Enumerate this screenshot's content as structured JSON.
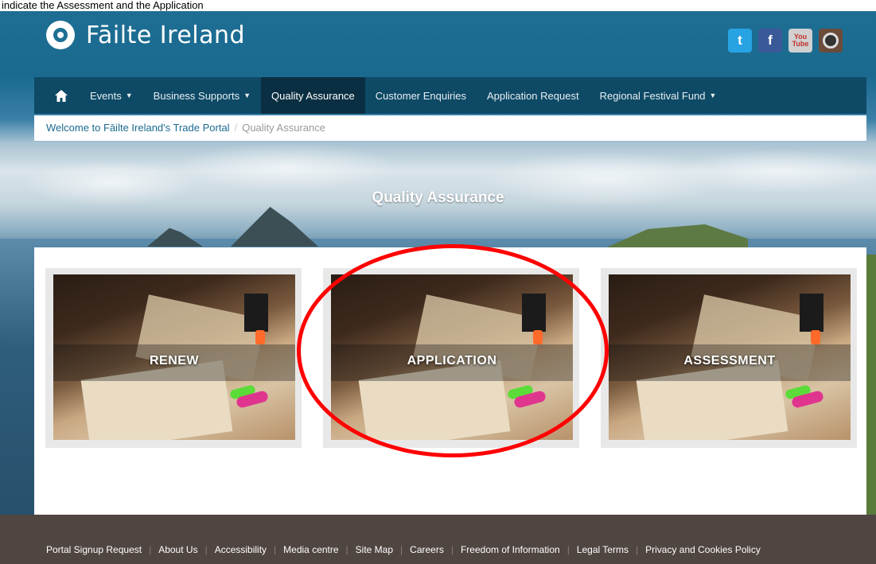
{
  "note": "indicate the Assessment and the Application",
  "header": {
    "brand": "Fāilte Ireland",
    "social": [
      {
        "name": "twitter",
        "glyph": "t"
      },
      {
        "name": "facebook",
        "glyph": "f"
      },
      {
        "name": "youtube",
        "glyph": "You Tube"
      },
      {
        "name": "instagram",
        "glyph": ""
      }
    ]
  },
  "nav": {
    "home_icon": "home-icon",
    "items": [
      {
        "label": "Events",
        "dropdown": true
      },
      {
        "label": "Business Supports",
        "dropdown": true
      },
      {
        "label": "Quality Assurance",
        "active": true
      },
      {
        "label": "Customer Enquiries"
      },
      {
        "label": "Application Request"
      },
      {
        "label": "Regional Festival Fund",
        "dropdown": true
      }
    ],
    "caret": "▼"
  },
  "breadcrumb": {
    "home": "Welcome to Fāilte Ireland's Trade Portal",
    "separator": "/",
    "current": "Quality Assurance"
  },
  "hero": {
    "title": "Quality Assurance"
  },
  "tiles": [
    {
      "label": "RENEW"
    },
    {
      "label": "APPLICATION"
    },
    {
      "label": "ASSESSMENT"
    }
  ],
  "annotation": {
    "color": "#ff0000"
  },
  "footer": {
    "links": [
      "Portal Signup Request",
      "About Us",
      "Accessibility",
      "Media centre",
      "Site Map",
      "Careers",
      "Freedom of Information",
      "Legal Terms",
      "Privacy and Cookies Policy"
    ],
    "separator": "|"
  },
  "colors": {
    "brand_blue": "#1f6f95",
    "nav_bg": "#0e4a66",
    "nav_active": "#0a2f42",
    "footer_bg": "#4f4541",
    "link": "#1c6a8f"
  }
}
